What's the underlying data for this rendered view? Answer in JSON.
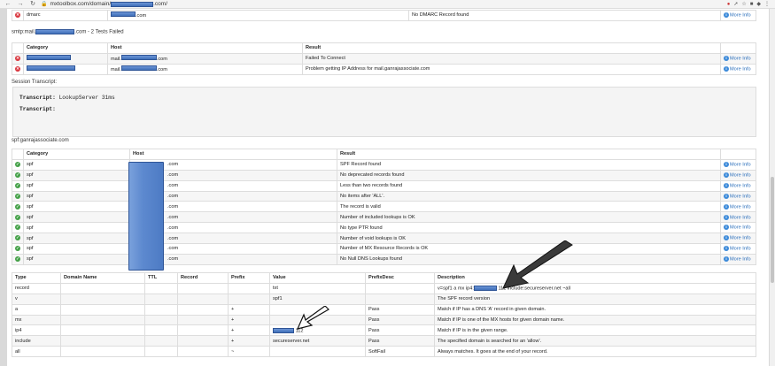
{
  "browser": {
    "url_prefix": "mxtoolbox.com/domain/",
    "url_suffix": ".com/"
  },
  "top_table": {
    "row": {
      "category": "dmarc",
      "host_suffix": ".com",
      "result": "No DMARC Record found",
      "more": "More Info"
    }
  },
  "smtp": {
    "heading_prefix": "smtp:mail.",
    "heading_suffix": ".com - 2 Tests Failed",
    "headers": [
      "Category",
      "Host",
      "Result"
    ],
    "rows": [
      {
        "host_prefix": "mail.",
        "host_suffix": ".com",
        "result": "Failed To Connect",
        "more": "More Info"
      },
      {
        "host_prefix": "mail.",
        "host_suffix": ".com",
        "result": "Problem getting IP Address for mail.ganrajassociate.com",
        "more": "More Info"
      }
    ]
  },
  "transcript": {
    "label": "Session Transcript:",
    "line1_label": "Transcript:",
    "line1_value": "LookupServer 31ms",
    "line2_label": "Transcript:"
  },
  "spf": {
    "heading": "spf:ganrajassociate.com",
    "headers": [
      "Category",
      "Host",
      "Result"
    ],
    "rows": [
      {
        "category": "spf",
        "host": ".com",
        "result": "SPF Record found",
        "more": "More Info"
      },
      {
        "category": "spf",
        "host": ".com",
        "result": "No deprecated records found",
        "more": "More Info"
      },
      {
        "category": "spf",
        "host": ".com",
        "result": "Less than two records found",
        "more": "More Info"
      },
      {
        "category": "spf",
        "host": ".com",
        "result": "No items after 'ALL'.",
        "more": "More Info"
      },
      {
        "category": "spf",
        "host": ".com",
        "result": "The record is valid",
        "more": "More Info"
      },
      {
        "category": "spf",
        "host": ".com",
        "result": "Number of included lookups is OK",
        "more": "More Info"
      },
      {
        "category": "spf",
        "host": ".com",
        "result": "No type PTR found",
        "more": "More Info"
      },
      {
        "category": "spf",
        "host": ".com",
        "result": "Number of void lookups is OK",
        "more": "More Info"
      },
      {
        "category": "spf",
        "host": ".com",
        "result": "Number of MX Resource Records is OK",
        "more": "More Info"
      },
      {
        "category": "spf",
        "host": ".com",
        "result": "No Null DNS Lookups found",
        "more": "More Info"
      }
    ]
  },
  "records": {
    "headers": [
      "Type",
      "Domain Name",
      "TTL",
      "Record",
      "Prefix",
      "Value",
      "PrefixDesc",
      "Description"
    ],
    "rows": [
      {
        "type": "record",
        "prefix": "",
        "value": "txt",
        "prefixdesc": "",
        "description": "v=spf1 a mx ip4:",
        "description_tail": "112 include:secureserver.net ~all"
      },
      {
        "type": "v",
        "prefix": "",
        "value": "spf1",
        "prefixdesc": "",
        "description": "The SPF record version",
        "description_tail": ""
      },
      {
        "type": "a",
        "prefix": "+",
        "value": "",
        "prefixdesc": "Pass",
        "description": "Match if IP has a DNS 'A' record in given domain.",
        "description_tail": ""
      },
      {
        "type": "mx",
        "prefix": "+",
        "value": "",
        "prefixdesc": "Pass",
        "description": "Match if IP is one of the MX hosts for given domain name.",
        "description_tail": ""
      },
      {
        "type": "ip4",
        "prefix": "+",
        "value": "112",
        "prefixdesc": "Pass",
        "description": "Match if IP is in the given range.",
        "description_tail": ""
      },
      {
        "type": "include",
        "prefix": "+",
        "value": "secureserver.net",
        "prefixdesc": "Pass",
        "description": "The specified domain is searched for an 'allow'.",
        "description_tail": ""
      },
      {
        "type": "all",
        "prefix": "~",
        "value": "",
        "prefixdesc": "SoftFail",
        "description": "Always matches. It goes at the end of your record.",
        "description_tail": ""
      }
    ]
  },
  "icons": {
    "error": "x-circle-icon",
    "ok": "check-circle-icon",
    "info": "info-icon"
  }
}
